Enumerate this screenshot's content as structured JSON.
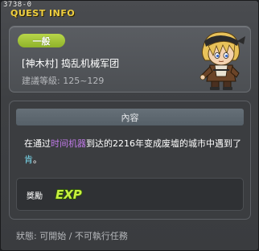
{
  "window": {
    "quest_id": "3738-0",
    "title": "QUEST INFO"
  },
  "quest": {
    "category": "一般",
    "name": "[神木村] 捣乱机械军团",
    "level_range": "建議等級: 125~129",
    "npc_icon": "npc-portrait-icon"
  },
  "content": {
    "header": "內容",
    "desc_part1": "在通过",
    "desc_highlight1": "时间机器",
    "desc_part2": "到达的2216年变成废墟的城市中遇到了",
    "desc_highlight2": "肯",
    "desc_part3": "。",
    "reward_label": "獎勵",
    "reward_icon": "exp-icon"
  },
  "status": "狀態: 可開始 / 不可執行任務",
  "colors": {
    "title": "#f0d040",
    "pill": "#a4c63a",
    "highlight_purple": "#c07ae8",
    "highlight_cyan": "#7adcf0"
  }
}
